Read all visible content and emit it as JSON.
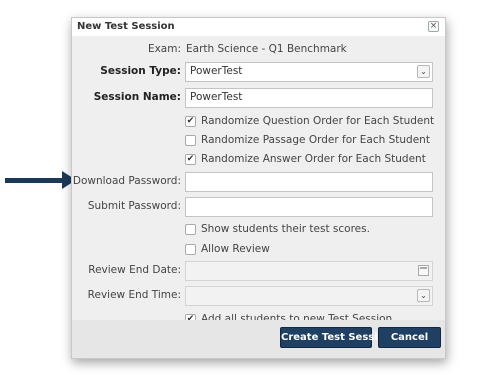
{
  "dialog": {
    "title": "New Test Session",
    "close_glyph": "×",
    "exam_label": "Exam:",
    "exam_value": "Earth Science - Q1 Benchmark",
    "session_type_label": "Session Type:",
    "session_type_value": "PowerTest",
    "session_name_label": "Session Name:",
    "session_name_value": "PowerTest",
    "options": [
      {
        "label": "Randomize Question Order for Each Student",
        "checked": true
      },
      {
        "label": "Randomize Passage Order for Each Student",
        "checked": false
      },
      {
        "label": "Randomize Answer Order for Each Student",
        "checked": true
      }
    ],
    "download_password_label": "Download Password:",
    "download_password_value": "",
    "submit_password_label": "Submit Password:",
    "submit_password_value": "",
    "show_scores_label": "Show students their test scores.",
    "show_scores_checked": false,
    "allow_review_label": "Allow Review",
    "allow_review_checked": false,
    "review_end_date_label": "Review End Date:",
    "review_end_date_value": "",
    "review_end_time_label": "Review End Time:",
    "review_end_time_value": "",
    "add_students_label": "Add all students to new Test Session",
    "add_students_checked": true,
    "create_button": "Create Test Session",
    "cancel_button": "Cancel",
    "button_color": "#1f3f63",
    "check_glyph": "✔",
    "dropdown_glyph": "⌄"
  },
  "annotation": {
    "arrow_color": "#1b3a57",
    "icon": "arrow-right-icon"
  }
}
